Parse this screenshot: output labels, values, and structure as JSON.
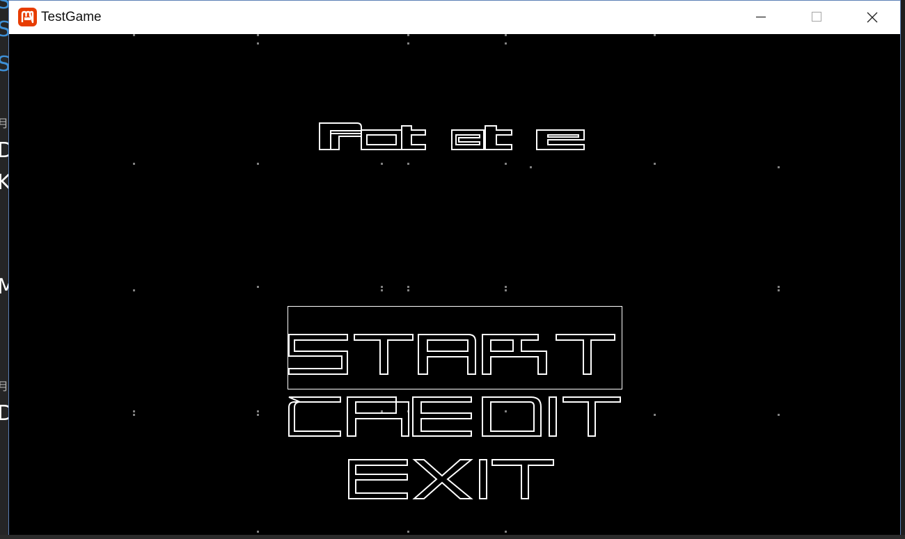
{
  "window": {
    "title": "TestGame",
    "accent": "#e73c00",
    "border_color": "#5b7fb5"
  },
  "icons": {
    "app": "monogame-logo-icon",
    "minimize": "minimize-icon",
    "maximize": "maximize-icon",
    "close": "close-icon"
  },
  "game": {
    "background": "#000000",
    "foreground": "#ffffff",
    "dot_color": "#808080",
    "title": "Rotate",
    "menu": [
      {
        "id": "start",
        "label": "START",
        "selected": true
      },
      {
        "id": "credit",
        "label": "CREDIT",
        "selected": false
      },
      {
        "id": "exit",
        "label": "EXIT",
        "selected": false
      }
    ]
  }
}
